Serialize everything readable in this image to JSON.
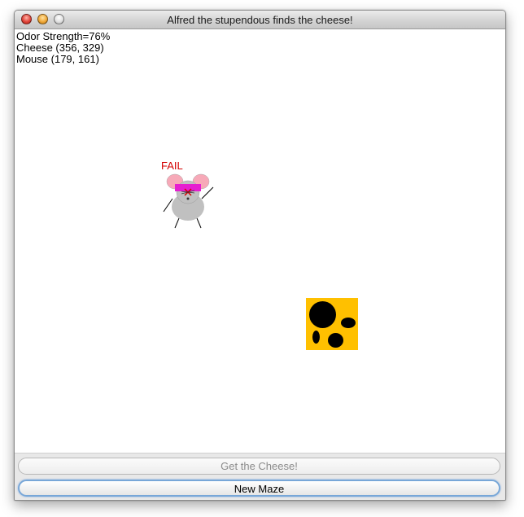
{
  "window": {
    "title": "Alfred the stupendous finds the cheese!"
  },
  "info": {
    "odor": "Odor Strength=76%",
    "cheese": "Cheese (356, 329)",
    "mouse": "Mouse (179, 161)"
  },
  "mouse": {
    "status_label": "FAIL",
    "status_color": "#d40000",
    "body_color": "#c0c0c0",
    "ear_color": "#f7a9b8",
    "headband_color": "#e61fd0"
  },
  "cheese": {
    "color": "#ffc000"
  },
  "buttons": {
    "get_cheese": "Get the Cheese!",
    "new_maze": "New Maze"
  },
  "icons": {
    "close": "close-icon",
    "minimize": "minimize-icon",
    "zoom": "zoom-icon"
  }
}
